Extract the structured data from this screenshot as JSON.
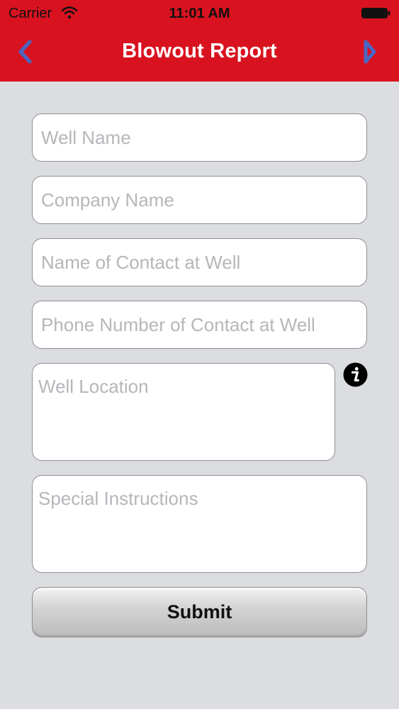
{
  "status_bar": {
    "carrier": "Carrier",
    "time": "11:01 AM"
  },
  "header": {
    "title": "Blowout Report",
    "back_icon": "chevron-left-icon",
    "forward_icon": "chevron-right-icon",
    "background_color": "#d8131f",
    "icon_color": "#4a67c4"
  },
  "form": {
    "well_name_placeholder": "Well Name",
    "company_name_placeholder": "Company Name",
    "contact_name_placeholder": "Name of Contact at Well",
    "contact_phone_placeholder": "Phone Number of Contact at Well",
    "well_location_placeholder": "Well Location",
    "special_instructions_placeholder": "Special Instructions",
    "info_icon": "info-icon",
    "submit_label": "Submit"
  }
}
